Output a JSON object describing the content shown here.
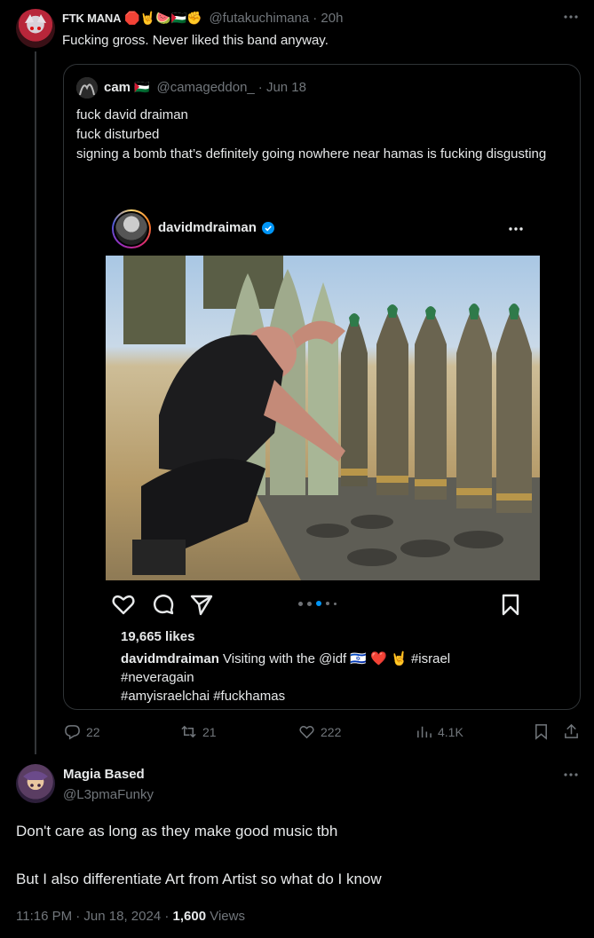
{
  "tweet1": {
    "name": "FTK MANA",
    "name_emojis": "🛑🤘🍉🇵🇸✊",
    "handle": "@futakuchimana",
    "time": "· 20h",
    "text": "Fucking gross. Never liked this band anyway.",
    "more_icon": "more-dots-icon",
    "stats": {
      "replies": "22",
      "retweets": "21",
      "likes": "222",
      "views": "4.1K"
    }
  },
  "quoted": {
    "name": "cam",
    "name_emoji": "🇵🇸",
    "handle": "@camageddon_",
    "time": "· Jun 18",
    "lines": [
      "fuck david draiman",
      "fuck disturbed",
      "signing a bomb that’s definitely going nowhere near hamas is fucking disgusting"
    ]
  },
  "instagram": {
    "username": "davidmdraiman",
    "likes": "19,665 likes",
    "caption_user": "davidmdraiman",
    "caption_text": "Visiting with the @idf 🇮🇱 ❤️ 🤘",
    "caption_tag1": "#israel",
    "caption_tag2": "#neveragain",
    "caption_tag3": "#amyisraelchai #fuckhamas",
    "carousel_dots": 5,
    "active_dot": 2
  },
  "tweet2": {
    "name": "Magia Based",
    "handle": "@L3pmaFunky",
    "text1": "Don't care as long as they make good music tbh",
    "text2": "But I also differentiate Art from Artist so what do I know",
    "meta_time": "11:16 PM · Jun 18, 2024 ·",
    "views_count": "1,600",
    "views_label": "Views"
  },
  "colors": {
    "background": "#000000",
    "text": "#e7e9ea",
    "muted": "#71767b",
    "border": "#2f3336",
    "verified": "#0095f6"
  }
}
